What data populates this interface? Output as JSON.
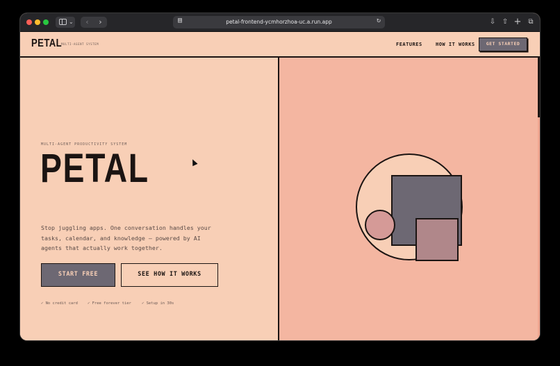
{
  "browser": {
    "url": "petal-frontend-ycmhorzhoa-uc.a.run.app",
    "icons": {
      "sidebar": "sidebar-icon",
      "back": "chevron-left-icon",
      "forward": "chevron-right-icon",
      "reload": "reload-icon",
      "download": "download-icon",
      "share": "share-icon",
      "new_tab": "plus-icon",
      "tabs": "tabs-overview-icon"
    }
  },
  "nav": {
    "brand": "PETAL",
    "brand_sub": "MULTI-AGENT SYSTEM",
    "links": [
      "FEATURES",
      "HOW IT WORKS"
    ],
    "cta": "GET STARTED"
  },
  "hero": {
    "eyebrow": "MULTI-AGENT PRODUCTIVITY SYSTEM",
    "title": "PETAL",
    "description": "Stop juggling apps. One conversation handles your tasks, calendar, and knowledge — powered by AI agents that actually work together.",
    "primary_cta": "START FREE",
    "secondary_cta": "SEE HOW IT WORKS",
    "perks": [
      "✓ No credit card",
      "✓ Free forever tier",
      "✓ Setup in 30s"
    ]
  },
  "colors": {
    "background": "#f8cfb6",
    "panel": "#f4b6a1",
    "ink": "#1b1412",
    "slate": "#6d6873",
    "rose": "#d59a97",
    "mauve": "#b0878a"
  }
}
